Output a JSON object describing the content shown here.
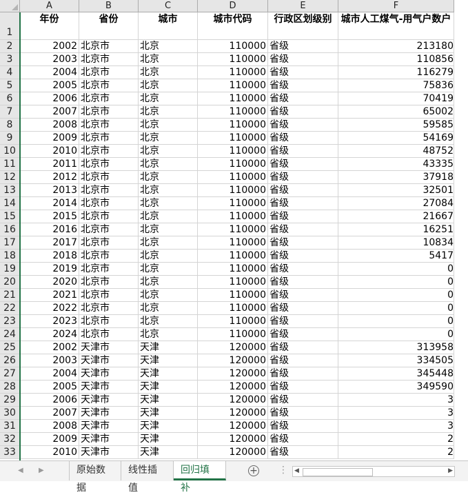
{
  "columns": [
    "A",
    "B",
    "C",
    "D",
    "E",
    "F"
  ],
  "headers": [
    "年份",
    "省份",
    "城市",
    "城市代码",
    "行政区划级别",
    "城市人工煤气-用气户数户"
  ],
  "header_row_number": "1",
  "rows": [
    [
      "2",
      "2002",
      "北京市",
      "北京",
      "110000",
      "省级",
      "213180"
    ],
    [
      "3",
      "2003",
      "北京市",
      "北京",
      "110000",
      "省级",
      "110856"
    ],
    [
      "4",
      "2004",
      "北京市",
      "北京",
      "110000",
      "省级",
      "116279"
    ],
    [
      "5",
      "2005",
      "北京市",
      "北京",
      "110000",
      "省级",
      "75836"
    ],
    [
      "6",
      "2006",
      "北京市",
      "北京",
      "110000",
      "省级",
      "70419"
    ],
    [
      "7",
      "2007",
      "北京市",
      "北京",
      "110000",
      "省级",
      "65002"
    ],
    [
      "8",
      "2008",
      "北京市",
      "北京",
      "110000",
      "省级",
      "59585"
    ],
    [
      "9",
      "2009",
      "北京市",
      "北京",
      "110000",
      "省级",
      "54169"
    ],
    [
      "10",
      "2010",
      "北京市",
      "北京",
      "110000",
      "省级",
      "48752"
    ],
    [
      "11",
      "2011",
      "北京市",
      "北京",
      "110000",
      "省级",
      "43335"
    ],
    [
      "12",
      "2012",
      "北京市",
      "北京",
      "110000",
      "省级",
      "37918"
    ],
    [
      "13",
      "2013",
      "北京市",
      "北京",
      "110000",
      "省级",
      "32501"
    ],
    [
      "14",
      "2014",
      "北京市",
      "北京",
      "110000",
      "省级",
      "27084"
    ],
    [
      "15",
      "2015",
      "北京市",
      "北京",
      "110000",
      "省级",
      "21667"
    ],
    [
      "16",
      "2016",
      "北京市",
      "北京",
      "110000",
      "省级",
      "16251"
    ],
    [
      "17",
      "2017",
      "北京市",
      "北京",
      "110000",
      "省级",
      "10834"
    ],
    [
      "18",
      "2018",
      "北京市",
      "北京",
      "110000",
      "省级",
      "5417"
    ],
    [
      "19",
      "2019",
      "北京市",
      "北京",
      "110000",
      "省级",
      "0"
    ],
    [
      "20",
      "2020",
      "北京市",
      "北京",
      "110000",
      "省级",
      "0"
    ],
    [
      "21",
      "2021",
      "北京市",
      "北京",
      "110000",
      "省级",
      "0"
    ],
    [
      "22",
      "2022",
      "北京市",
      "北京",
      "110000",
      "省级",
      "0"
    ],
    [
      "23",
      "2023",
      "北京市",
      "北京",
      "110000",
      "省级",
      "0"
    ],
    [
      "24",
      "2024",
      "北京市",
      "北京",
      "110000",
      "省级",
      "0"
    ],
    [
      "25",
      "2002",
      "天津市",
      "天津",
      "120000",
      "省级",
      "313958"
    ],
    [
      "26",
      "2003",
      "天津市",
      "天津",
      "120000",
      "省级",
      "334505"
    ],
    [
      "27",
      "2004",
      "天津市",
      "天津",
      "120000",
      "省级",
      "345448"
    ],
    [
      "28",
      "2005",
      "天津市",
      "天津",
      "120000",
      "省级",
      "349590"
    ],
    [
      "29",
      "2006",
      "天津市",
      "天津",
      "120000",
      "省级",
      "3"
    ],
    [
      "30",
      "2007",
      "天津市",
      "天津",
      "120000",
      "省级",
      "3"
    ],
    [
      "31",
      "2008",
      "天津市",
      "天津",
      "120000",
      "省级",
      "3"
    ],
    [
      "32",
      "2009",
      "天津市",
      "天津",
      "120000",
      "省级",
      "2"
    ],
    [
      "33",
      "2010",
      "天津市",
      "天津",
      "120000",
      "省级",
      "2"
    ]
  ],
  "sheet_tabs": [
    "原始数据",
    "线性插值",
    "回归填补"
  ],
  "active_tab": "回归填补",
  "add_sheet_glyph": "+",
  "nav_prev": "◀",
  "nav_next": "▶",
  "tab_more": "…",
  "vdots": "⋮",
  "scroll_left": "◀",
  "scroll_right": "▶"
}
